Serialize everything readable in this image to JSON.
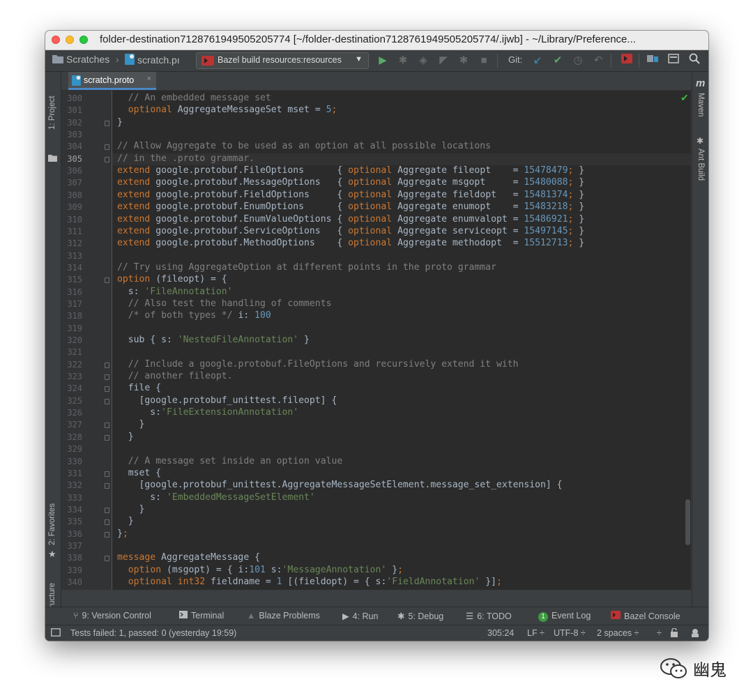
{
  "window": {
    "title": "folder-destination7128761949505205774 [~/folder-destination7128761949505205774/.ijwb] - ~/Library/Preference..."
  },
  "navbar": {
    "breadcrumb_root": "Scratches",
    "breadcrumb_file": "scratch.pı",
    "run_config": "Bazel build resources:resources",
    "git_label": "Git:"
  },
  "tab": {
    "label": "scratch.proto"
  },
  "side_tools": {
    "left_project": "1: Project",
    "left_favorites": "2: Favorites",
    "left_structure": "Z: Structure",
    "right_maven": "Maven",
    "right_ant": "Ant Build"
  },
  "editor": {
    "current_line": "305",
    "lines": [
      {
        "n": "300",
        "text": "  // An embedded message set"
      },
      {
        "n": "301",
        "text": "  optional AggregateMessageSet mset = 5;"
      },
      {
        "n": "302",
        "text": "}"
      },
      {
        "n": "303",
        "text": ""
      },
      {
        "n": "304",
        "text": "// Allow Aggregate to be used as an option at all possible locations"
      },
      {
        "n": "305",
        "text": "// in the .proto grammar."
      },
      {
        "n": "306",
        "text": "extend google.protobuf.FileOptions      { optional Aggregate fileopt    = 15478479; }"
      },
      {
        "n": "307",
        "text": "extend google.protobuf.MessageOptions   { optional Aggregate msgopt     = 15480088; }"
      },
      {
        "n": "308",
        "text": "extend google.protobuf.FieldOptions     { optional Aggregate fieldopt   = 15481374; }"
      },
      {
        "n": "309",
        "text": "extend google.protobuf.EnumOptions      { optional Aggregate enumopt    = 15483218; }"
      },
      {
        "n": "310",
        "text": "extend google.protobuf.EnumValueOptions { optional Aggregate enumvalopt = 15486921; }"
      },
      {
        "n": "311",
        "text": "extend google.protobuf.ServiceOptions   { optional Aggregate serviceopt = 15497145; }"
      },
      {
        "n": "312",
        "text": "extend google.protobuf.MethodOptions    { optional Aggregate methodopt  = 15512713; }"
      },
      {
        "n": "313",
        "text": ""
      },
      {
        "n": "314",
        "text": "// Try using AggregateOption at different points in the proto grammar"
      },
      {
        "n": "315",
        "text": "option (fileopt) = {"
      },
      {
        "n": "316",
        "text": "  s: 'FileAnnotation'"
      },
      {
        "n": "317",
        "text": "  // Also test the handling of comments"
      },
      {
        "n": "318",
        "text": "  /* of both types */ i: 100"
      },
      {
        "n": "319",
        "text": ""
      },
      {
        "n": "320",
        "text": "  sub { s: 'NestedFileAnnotation' }"
      },
      {
        "n": "321",
        "text": ""
      },
      {
        "n": "322",
        "text": "  // Include a google.protobuf.FileOptions and recursively extend it with"
      },
      {
        "n": "323",
        "text": "  // another fileopt."
      },
      {
        "n": "324",
        "text": "  file {"
      },
      {
        "n": "325",
        "text": "    [google.protobuf_unittest.fileopt] {"
      },
      {
        "n": "326",
        "text": "      s:'FileExtensionAnnotation'"
      },
      {
        "n": "327",
        "text": "    }"
      },
      {
        "n": "328",
        "text": "  }"
      },
      {
        "n": "329",
        "text": ""
      },
      {
        "n": "330",
        "text": "  // A message set inside an option value"
      },
      {
        "n": "331",
        "text": "  mset {"
      },
      {
        "n": "332",
        "text": "    [google.protobuf_unittest.AggregateMessageSetElement.message_set_extension] {"
      },
      {
        "n": "333",
        "text": "      s: 'EmbeddedMessageSetElement'"
      },
      {
        "n": "334",
        "text": "    }"
      },
      {
        "n": "335",
        "text": "  }"
      },
      {
        "n": "336",
        "text": "};"
      },
      {
        "n": "337",
        "text": ""
      },
      {
        "n": "338",
        "text": "message AggregateMessage {"
      },
      {
        "n": "339",
        "text": "  option (msgopt) = { i:101 s:'MessageAnnotation' };"
      },
      {
        "n": "340",
        "text": "  optional int32 fieldname = 1 [(fieldopt) = { s:'FieldAnnotation' }];"
      }
    ]
  },
  "toolwindows": {
    "version_control": "9: Version Control",
    "terminal": "Terminal",
    "blaze_problems": "Blaze Problems",
    "run": "4: Run",
    "debug": "5: Debug",
    "todo": "6: TODO",
    "event_log_count": "1",
    "event_log": "Event Log",
    "bazel_console": "Bazel Console"
  },
  "status": {
    "message": "Tests failed: 1, passed: 0 (yesterday 19:59)",
    "position": "305:24",
    "line_sep": "LF ÷",
    "encoding": "UTF-8 ÷",
    "indent": "2 spaces ÷",
    "extra": "÷"
  },
  "watermark": {
    "text": "幽鬼"
  },
  "colors": {
    "editor_bg": "#2b2b2b",
    "keyword": "#cc7832",
    "comment": "#808080",
    "number": "#6897bb",
    "string": "#6a8759",
    "identifier": "#a9b7c6"
  }
}
